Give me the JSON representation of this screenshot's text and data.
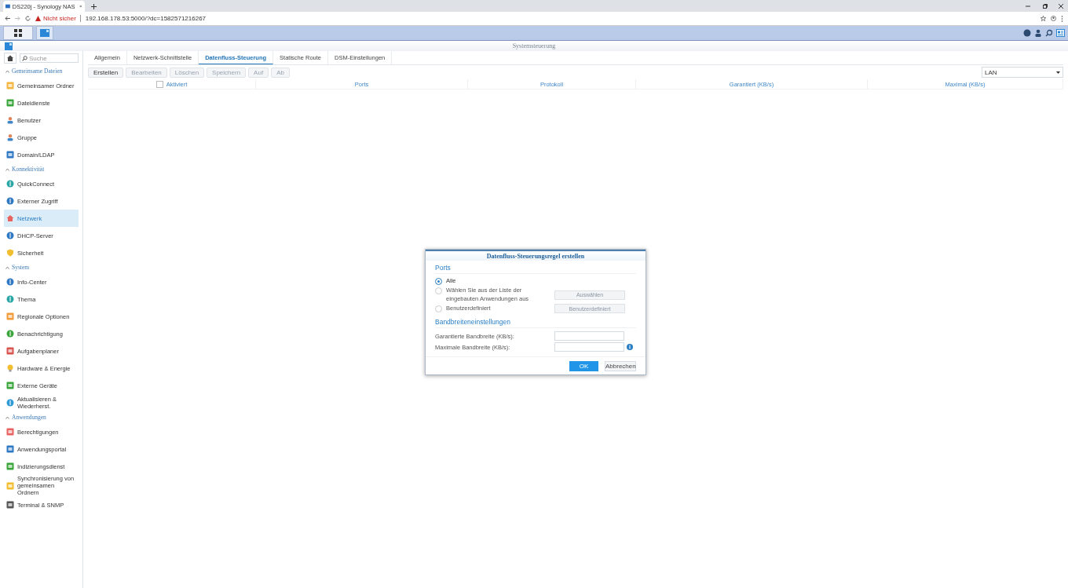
{
  "browser": {
    "tab_title": "DS220j - Synology NAS",
    "security": "Nicht sicher",
    "url": "192.168.178.53:5000/?dc=1582571216267"
  },
  "window": {
    "title": "Systemsteuerung"
  },
  "sidebar": {
    "search_placeholder": "Suche",
    "items": [
      {
        "kind": "section",
        "label": "Gemeinsame Dateien"
      },
      {
        "kind": "item",
        "label": "Gemeinsamer Ordner",
        "selected": false
      },
      {
        "kind": "item",
        "label": "Dateidienste",
        "selected": false
      },
      {
        "kind": "item",
        "label": "Benutzer",
        "selected": false
      },
      {
        "kind": "item",
        "label": "Gruppe",
        "selected": false
      },
      {
        "kind": "item",
        "label": "Domain/LDAP",
        "selected": false
      },
      {
        "kind": "section",
        "label": "Konnektivität"
      },
      {
        "kind": "item",
        "label": "QuickConnect",
        "selected": false
      },
      {
        "kind": "item",
        "label": "Externer Zugriff",
        "selected": false
      },
      {
        "kind": "item",
        "label": "Netzwerk",
        "selected": true
      },
      {
        "kind": "item",
        "label": "DHCP-Server",
        "selected": false
      },
      {
        "kind": "item",
        "label": "Sicherheit",
        "selected": false
      },
      {
        "kind": "section",
        "label": "System"
      },
      {
        "kind": "item",
        "label": "Info-Center",
        "selected": false
      },
      {
        "kind": "item",
        "label": "Thema",
        "selected": false
      },
      {
        "kind": "item",
        "label": "Regionale Optionen",
        "selected": false
      },
      {
        "kind": "item",
        "label": "Benachrichtigung",
        "selected": false
      },
      {
        "kind": "item",
        "label": "Aufgabenplaner",
        "selected": false
      },
      {
        "kind": "item",
        "label": "Hardware & Energie",
        "selected": false
      },
      {
        "kind": "item",
        "label": "Externe Geräte",
        "selected": false
      },
      {
        "kind": "item",
        "label": "Aktualisieren & Wiederherst.",
        "selected": false
      },
      {
        "kind": "section",
        "label": "Anwendungen"
      },
      {
        "kind": "item",
        "label": "Berechtigungen",
        "selected": false
      },
      {
        "kind": "item",
        "label": "Anwendungsportal",
        "selected": false
      },
      {
        "kind": "item",
        "label": "Indizierungsdienst",
        "selected": false
      },
      {
        "kind": "item",
        "label": "Synchronisierung von gemeinsamen Ordnern",
        "selected": false
      },
      {
        "kind": "item",
        "label": "Terminal & SNMP",
        "selected": false
      }
    ]
  },
  "tabs": [
    {
      "label": "Allgemein",
      "selected": false
    },
    {
      "label": "Netzwerk-Schnittstelle",
      "selected": false
    },
    {
      "label": "Datenfluss-Steuerung",
      "selected": true
    },
    {
      "label": "Statische Route",
      "selected": false
    },
    {
      "label": "DSM-Einstellungen",
      "selected": false
    }
  ],
  "toolbar": {
    "buttons": [
      {
        "label": "Erstellen",
        "disabled": false
      },
      {
        "label": "Bearbeiten",
        "disabled": true
      },
      {
        "label": "Löschen",
        "disabled": true
      },
      {
        "label": "Speichern",
        "disabled": true
      },
      {
        "label": "Auf",
        "disabled": true
      },
      {
        "label": "Ab",
        "disabled": true
      }
    ],
    "interface": "LAN"
  },
  "table": {
    "all_checked": false,
    "columns": [
      "Aktiviert",
      "Ports",
      "Protokoll",
      "Garantiert (KB/s)",
      "Maximal (KB/s)"
    ]
  },
  "dialog": {
    "title": "Datenfluss-Steuerungsregel erstellen",
    "ports_heading": "Ports",
    "options": [
      {
        "label": "Alle",
        "selected": true
      },
      {
        "label": "Wählen Sie aus der Liste der eingebauten Anwendungen aus",
        "selected": false,
        "button": "Auswählen"
      },
      {
        "label": "Benutzerdefiniert",
        "selected": false,
        "button": "Benutzerdefiniert"
      }
    ],
    "bandwidth_heading": "Bandbreiteneinstellungen",
    "fields": [
      {
        "label": "Garantierte Bandbreite (KB/s):",
        "info": false
      },
      {
        "label": "Maximale Bandbreite (KB/s):",
        "info": true
      }
    ],
    "ok": "OK",
    "cancel": "Abbrechen"
  }
}
